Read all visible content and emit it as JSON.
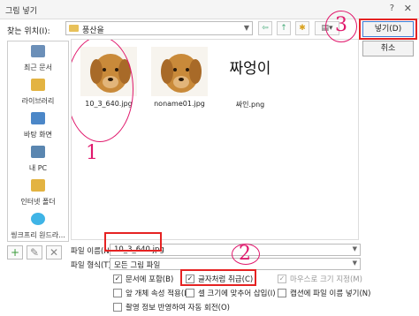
{
  "window": {
    "title": "그림 넣기",
    "help": "?",
    "close": "✕"
  },
  "lookin": {
    "label": "찾는 위치(I):",
    "value": "풍산을"
  },
  "toolbar": {
    "back": "⇦",
    "up": "↑",
    "new_folder": "✱",
    "views": "▤▾"
  },
  "places": [
    {
      "label": "최근 문서",
      "icon": "recent-docs-icon",
      "color": "#6b8fb8"
    },
    {
      "label": "라이브러리",
      "icon": "library-icon",
      "color": "#e3b341"
    },
    {
      "label": "바탕 화면",
      "icon": "desktop-icon",
      "color": "#4b87c8"
    },
    {
      "label": "내 PC",
      "icon": "computer-icon",
      "color": "#5a86b0"
    },
    {
      "label": "인터넷 폴더",
      "icon": "internet-folder-icon",
      "color": "#e3b341"
    },
    {
      "label": "씽크프리 원드라...",
      "icon": "thinkfree-drive-icon",
      "color": "#3fb4e6"
    }
  ],
  "files": [
    {
      "name": "10_3_640.jpg",
      "kind": "dog-photo"
    },
    {
      "name": "noname01.jpg",
      "kind": "dog-photo"
    },
    {
      "name": "싸인.png",
      "kind": "signature",
      "signature_text": "짜엉이"
    }
  ],
  "buttons": {
    "insert": "넣기(D)",
    "cancel": "취소"
  },
  "mini_buttons": {
    "add": "+",
    "edit": "✎",
    "delete": "✕"
  },
  "filename": {
    "label": "파일 이름(N):",
    "value": "10_3_640.jpg"
  },
  "filetype": {
    "label": "파일 형식(T):",
    "value": "모든 그림 파일"
  },
  "options": {
    "embed": {
      "label": "문서에 포함(B)",
      "checked": true
    },
    "as_char": {
      "label": "글자처럼 취급(C)",
      "checked": true
    },
    "mouse_size": {
      "label": "마우스로 크기 지정(M)",
      "checked": true
    },
    "apply_prev": {
      "label": "앞 개체 속성 적용(L)",
      "checked": false
    },
    "fit_cell": {
      "label": "셀 크기에 맞추어 삽입(I)",
      "checked": false
    },
    "caption": {
      "label": "캡션에 파일 이름 넣기(N)",
      "checked": false
    },
    "rotate": {
      "label": "촬영 정보 반영하여 자동 회전(O)",
      "checked": false
    }
  },
  "annotations": {
    "one": "1",
    "two": "2",
    "three": "3"
  },
  "colors": {
    "annotation_pink": "#e0186c",
    "annotation_red": "#e52222",
    "accent_blue": "#3a7bd5"
  }
}
